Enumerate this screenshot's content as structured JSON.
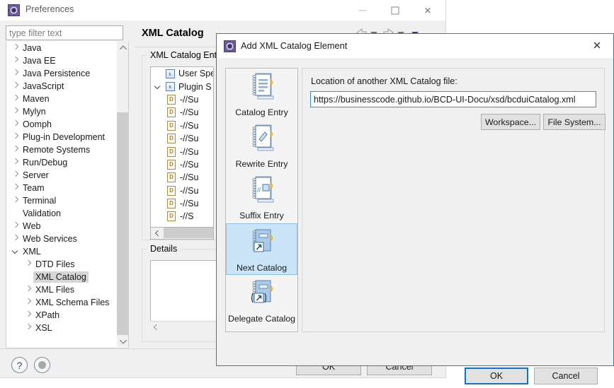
{
  "prefs_window": {
    "title": "Preferences",
    "icon": "preferences-gear-icon",
    "window_buttons": {
      "minimize": "minimize-icon",
      "maximize": "maximize-icon",
      "close": "close-icon"
    },
    "filter": {
      "placeholder": "type filter text",
      "value": ""
    },
    "tree": [
      {
        "label": "Java",
        "level": 1,
        "expandable": true,
        "expanded": false,
        "selected": false
      },
      {
        "label": "Java EE",
        "level": 1,
        "expandable": true,
        "expanded": false,
        "selected": false
      },
      {
        "label": "Java Persistence",
        "level": 1,
        "expandable": true,
        "expanded": false,
        "selected": false
      },
      {
        "label": "JavaScript",
        "level": 1,
        "expandable": true,
        "expanded": false,
        "selected": false
      },
      {
        "label": "Maven",
        "level": 1,
        "expandable": true,
        "expanded": false,
        "selected": false
      },
      {
        "label": "Mylyn",
        "level": 1,
        "expandable": true,
        "expanded": false,
        "selected": false
      },
      {
        "label": "Oomph",
        "level": 1,
        "expandable": true,
        "expanded": false,
        "selected": false
      },
      {
        "label": "Plug-in Development",
        "level": 1,
        "expandable": true,
        "expanded": false,
        "selected": false
      },
      {
        "label": "Remote Systems",
        "level": 1,
        "expandable": true,
        "expanded": false,
        "selected": false
      },
      {
        "label": "Run/Debug",
        "level": 1,
        "expandable": true,
        "expanded": false,
        "selected": false
      },
      {
        "label": "Server",
        "level": 1,
        "expandable": true,
        "expanded": false,
        "selected": false
      },
      {
        "label": "Team",
        "level": 1,
        "expandable": true,
        "expanded": false,
        "selected": false
      },
      {
        "label": "Terminal",
        "level": 1,
        "expandable": true,
        "expanded": false,
        "selected": false
      },
      {
        "label": "Validation",
        "level": 1,
        "expandable": false,
        "expanded": false,
        "selected": false
      },
      {
        "label": "Web",
        "level": 1,
        "expandable": true,
        "expanded": false,
        "selected": false
      },
      {
        "label": "Web Services",
        "level": 1,
        "expandable": true,
        "expanded": false,
        "selected": false
      },
      {
        "label": "XML",
        "level": 1,
        "expandable": true,
        "expanded": true,
        "selected": false
      },
      {
        "label": "DTD Files",
        "level": 2,
        "expandable": true,
        "expanded": false,
        "selected": false
      },
      {
        "label": "XML Catalog",
        "level": 2,
        "expandable": false,
        "expanded": false,
        "selected": true
      },
      {
        "label": "XML Files",
        "level": 2,
        "expandable": true,
        "expanded": false,
        "selected": false
      },
      {
        "label": "XML Schema Files",
        "level": 2,
        "expandable": true,
        "expanded": false,
        "selected": false
      },
      {
        "label": "XPath",
        "level": 2,
        "expandable": true,
        "expanded": false,
        "selected": false
      },
      {
        "label": "XSL",
        "level": 2,
        "expandable": true,
        "expanded": false,
        "selected": false
      }
    ],
    "page": {
      "title": "XML Catalog",
      "nav": {
        "back": "back-arrow-icon",
        "back_menu": "back-dropdown-icon",
        "forward": "forward-arrow-icon",
        "forward_menu": "forward-dropdown-icon",
        "more": "more-dropdown-icon"
      },
      "entries_group_label": "XML Catalog Entries",
      "entries_tree": [
        {
          "label": "User Spe",
          "icon": "xml-catalog-icon",
          "level": 1,
          "expandable": false,
          "expanded": false
        },
        {
          "label": "Plugin S",
          "icon": "xml-catalog-icon",
          "level": 1,
          "expandable": true,
          "expanded": true
        },
        {
          "label": "-//Su",
          "icon": "dtd-document-icon",
          "level": 2
        },
        {
          "label": "-//Su",
          "icon": "dtd-document-icon",
          "level": 2
        },
        {
          "label": "-//Su",
          "icon": "dtd-document-icon",
          "level": 2
        },
        {
          "label": "-//Su",
          "icon": "dtd-document-icon",
          "level": 2
        },
        {
          "label": "-//Su",
          "icon": "dtd-document-icon",
          "level": 2
        },
        {
          "label": "-//Su",
          "icon": "dtd-document-icon",
          "level": 2
        },
        {
          "label": "-//Su",
          "icon": "dtd-document-icon",
          "level": 2
        },
        {
          "label": "-//Su",
          "icon": "dtd-document-icon",
          "level": 2
        },
        {
          "label": "-//Su",
          "icon": "dtd-document-icon",
          "level": 2
        },
        {
          "label": "-//S",
          "icon": "dtd-document-icon",
          "level": 2
        }
      ],
      "details_group_label": "Details",
      "details_value": ""
    },
    "bottom": {
      "help": "?",
      "help_name": "help-icon",
      "apply_all": "apply-and-close-icon",
      "ok_label": "OK",
      "cancel_label": "Cancel"
    }
  },
  "dialog": {
    "title": "Add XML Catalog Element",
    "icon": "eclipse-dialog-icon",
    "close_icon": "close-icon",
    "types": [
      {
        "label": "Catalog Entry",
        "icon": "catalog-entry-icon",
        "selected": false
      },
      {
        "label": "Rewrite Entry",
        "icon": "rewrite-entry-icon",
        "selected": false
      },
      {
        "label": "Suffix Entry",
        "icon": "suffix-entry-icon",
        "selected": false
      },
      {
        "label": "Next Catalog",
        "icon": "next-catalog-icon",
        "selected": true
      },
      {
        "label": "Delegate Catalog",
        "icon": "delegate-catalog-icon",
        "selected": false
      }
    ],
    "location_label": "Location of another XML Catalog file:",
    "location_value": "https://businesscode.github.io/BCD-UI-Docu/xsd/bcduiCatalog.xml",
    "location_placeholder": "",
    "workspace_label": "Workspace...",
    "filesystem_label": "File System...",
    "ok_label": "OK",
    "cancel_label": "Cancel"
  },
  "colors": {
    "dialog_border": "#1f7fd0",
    "focus_blue": "#0a74d0",
    "selection_blue": "#cce4f7",
    "tree_selection_gray": "#d6d6d6",
    "window_bg": "#f0f0f0"
  }
}
